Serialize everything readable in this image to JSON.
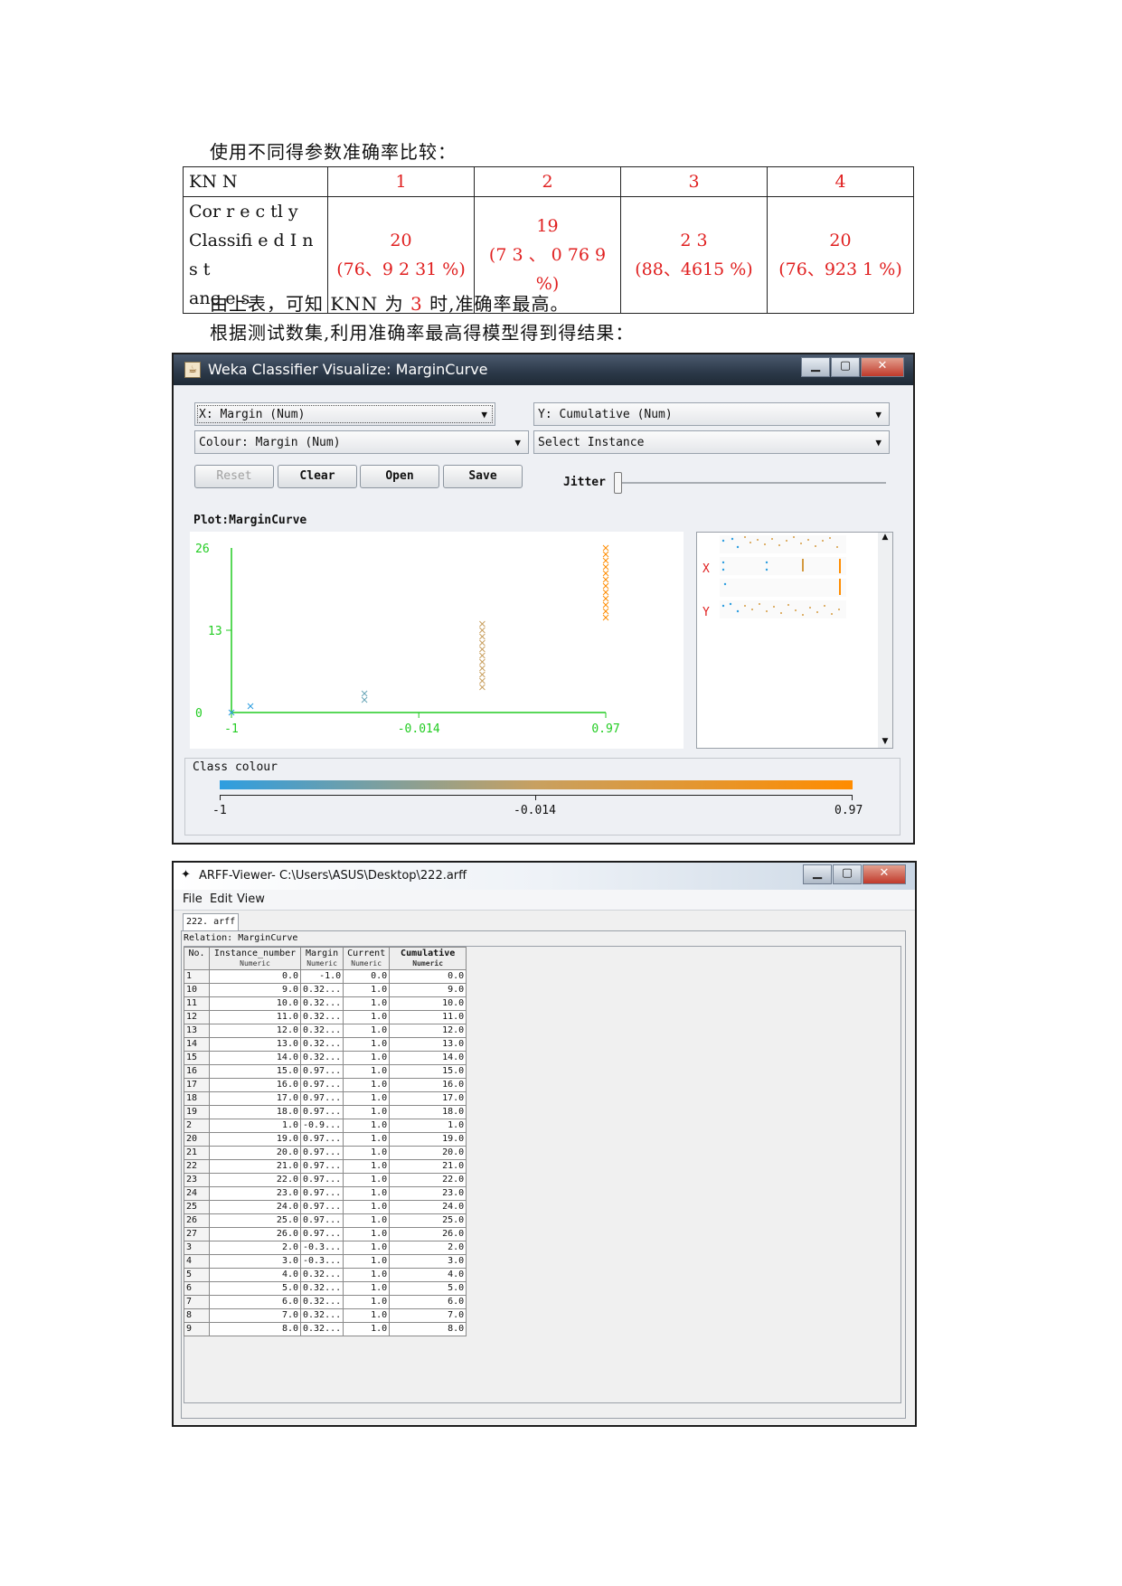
{
  "intro_text": "使用不同得参数准确率比较：",
  "table": {
    "header_label": "KN N",
    "k_values": [
      "1",
      "2",
      "3",
      "4"
    ],
    "row_label_lines": [
      "Cor  r e c tl  y",
      "Classifi e d I n s t",
      "anc e s"
    ],
    "cells": [
      {
        "count": "20",
        "pct": "(76、9 2 31  %)"
      },
      {
        "count": "19",
        "pct": "(7 3 、 0 76 9",
        "pct2": "%)"
      },
      {
        "count": "2 3",
        "pct": "(88、4615    %)"
      },
      {
        "count": "20",
        "pct": "(76、923 1  %)"
      }
    ]
  },
  "conclusion": {
    "before": "由上表，可知 KNN 为 ",
    "k": "3",
    "after": " 时,准确率最高。"
  },
  "result_text": "根据测试数集,利用准确率最高得模型得到得结果：",
  "weka": {
    "title": "Weka Classifier Visualize: MarginCurve",
    "x_select": "X: Margin (Num)",
    "y_select": "Y: Cumulative (Num)",
    "colour_select": "Colour: Margin (Num)",
    "instance_select": "Select Instance",
    "buttons": {
      "reset": "Reset",
      "clear": "Clear",
      "open": "Open",
      "save": "Save"
    },
    "jitter_label": "Jitter",
    "plot_label": "Plot:MarginCurve",
    "class_colour_label": "Class colour",
    "colour_ticks": [
      "-1",
      "-0.014",
      "0.97"
    ],
    "mini_x": "X",
    "mini_y": "Y"
  },
  "chart_data": {
    "type": "scatter",
    "title": "Plot:MarginCurve",
    "x_ticks": [
      "-1",
      "-0.014",
      "0.97"
    ],
    "y_ticks": [
      "0",
      "13",
      "26"
    ],
    "xlim": [
      -1,
      0.97
    ],
    "ylim": [
      0,
      26
    ],
    "marker": "x",
    "points": [
      {
        "x": -1.0,
        "y": 0
      },
      {
        "x": -0.9,
        "y": 1
      },
      {
        "x": -0.3,
        "y": 2
      },
      {
        "x": -0.3,
        "y": 3
      },
      {
        "x": 0.32,
        "y": 4
      },
      {
        "x": 0.32,
        "y": 5
      },
      {
        "x": 0.32,
        "y": 6
      },
      {
        "x": 0.32,
        "y": 7
      },
      {
        "x": 0.32,
        "y": 8
      },
      {
        "x": 0.32,
        "y": 9
      },
      {
        "x": 0.32,
        "y": 10
      },
      {
        "x": 0.32,
        "y": 11
      },
      {
        "x": 0.32,
        "y": 12
      },
      {
        "x": 0.32,
        "y": 13
      },
      {
        "x": 0.32,
        "y": 14
      },
      {
        "x": 0.97,
        "y": 15
      },
      {
        "x": 0.97,
        "y": 16
      },
      {
        "x": 0.97,
        "y": 17
      },
      {
        "x": 0.97,
        "y": 18
      },
      {
        "x": 0.97,
        "y": 19
      },
      {
        "x": 0.97,
        "y": 20
      },
      {
        "x": 0.97,
        "y": 21
      },
      {
        "x": 0.97,
        "y": 22
      },
      {
        "x": 0.97,
        "y": 23
      },
      {
        "x": 0.97,
        "y": 24
      },
      {
        "x": 0.97,
        "y": 25
      },
      {
        "x": 0.97,
        "y": 26
      }
    ],
    "colour_scale": [
      "#2e9ee0",
      "#c8a060",
      "#ff8c00"
    ]
  },
  "arff": {
    "title": "ARFF-Viewer- C:\\Users\\ASUS\\Desktop\\222.arff",
    "menu": [
      "File",
      "Edit",
      "View"
    ],
    "tab": "222. arff",
    "relation": "Relation: MarginCurve",
    "columns": [
      {
        "name": "No.",
        "type": ""
      },
      {
        "name": "Instance_number",
        "type": "Numeric"
      },
      {
        "name": "Margin",
        "type": "Numeric"
      },
      {
        "name": "Current",
        "type": "Numeric"
      },
      {
        "name": "Cumulative",
        "type": "Numeric"
      }
    ],
    "rows": [
      [
        "1",
        "0.0",
        "-1.0",
        "0.0",
        "0.0"
      ],
      [
        "10",
        "9.0",
        "0.32...",
        "1.0",
        "9.0"
      ],
      [
        "11",
        "10.0",
        "0.32...",
        "1.0",
        "10.0"
      ],
      [
        "12",
        "11.0",
        "0.32...",
        "1.0",
        "11.0"
      ],
      [
        "13",
        "12.0",
        "0.32...",
        "1.0",
        "12.0"
      ],
      [
        "14",
        "13.0",
        "0.32...",
        "1.0",
        "13.0"
      ],
      [
        "15",
        "14.0",
        "0.32...",
        "1.0",
        "14.0"
      ],
      [
        "16",
        "15.0",
        "0.97...",
        "1.0",
        "15.0"
      ],
      [
        "17",
        "16.0",
        "0.97...",
        "1.0",
        "16.0"
      ],
      [
        "18",
        "17.0",
        "0.97...",
        "1.0",
        "17.0"
      ],
      [
        "19",
        "18.0",
        "0.97...",
        "1.0",
        "18.0"
      ],
      [
        "2",
        "1.0",
        "-0.9...",
        "1.0",
        "1.0"
      ],
      [
        "20",
        "19.0",
        "0.97...",
        "1.0",
        "19.0"
      ],
      [
        "21",
        "20.0",
        "0.97...",
        "1.0",
        "20.0"
      ],
      [
        "22",
        "21.0",
        "0.97...",
        "1.0",
        "21.0"
      ],
      [
        "23",
        "22.0",
        "0.97...",
        "1.0",
        "22.0"
      ],
      [
        "24",
        "23.0",
        "0.97...",
        "1.0",
        "23.0"
      ],
      [
        "25",
        "24.0",
        "0.97...",
        "1.0",
        "24.0"
      ],
      [
        "26",
        "25.0",
        "0.97...",
        "1.0",
        "25.0"
      ],
      [
        "27",
        "26.0",
        "0.97...",
        "1.0",
        "26.0"
      ],
      [
        "3",
        "2.0",
        "-0.3...",
        "1.0",
        "2.0"
      ],
      [
        "4",
        "3.0",
        "-0.3...",
        "1.0",
        "3.0"
      ],
      [
        "5",
        "4.0",
        "0.32...",
        "1.0",
        "4.0"
      ],
      [
        "6",
        "5.0",
        "0.32...",
        "1.0",
        "5.0"
      ],
      [
        "7",
        "6.0",
        "0.32...",
        "1.0",
        "6.0"
      ],
      [
        "8",
        "7.0",
        "0.32...",
        "1.0",
        "7.0"
      ],
      [
        "9",
        "8.0",
        "0.32...",
        "1.0",
        "8.0"
      ]
    ]
  }
}
